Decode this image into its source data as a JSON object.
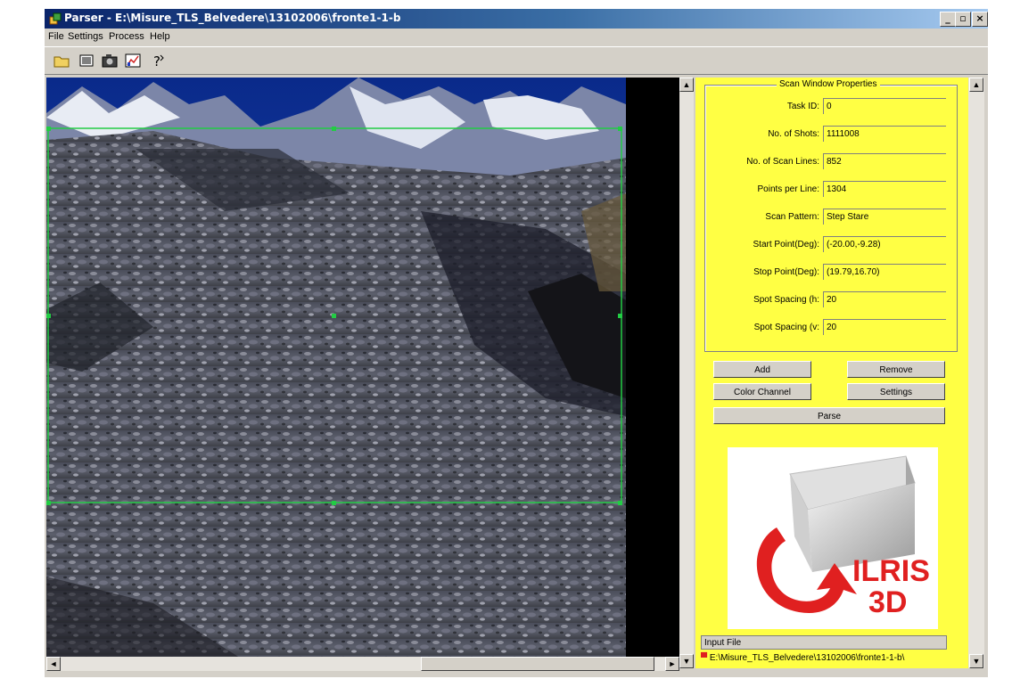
{
  "window": {
    "title": "Parser - E:\\Misure_TLS_Belvedere\\13102006\\fronte1-1-b",
    "minimize": "_",
    "maximize": "▫",
    "close": "×"
  },
  "menu": {
    "file": "File",
    "settings": "Settings",
    "process": "Process",
    "help": "Help"
  },
  "toolbar": {
    "icons": [
      "open-folder-icon",
      "image-icon",
      "camera-icon",
      "chart-icon",
      "help-icon"
    ]
  },
  "panel": {
    "group_title": "Scan Window Properties",
    "properties": [
      {
        "label": "Task ID:",
        "value": "0"
      },
      {
        "label": "No. of Shots:",
        "value": "1111008"
      },
      {
        "label": "No. of Scan Lines:",
        "value": "852"
      },
      {
        "label": "Points per Line:",
        "value": "1304"
      },
      {
        "label": "Scan Pattern:",
        "value": "Step Stare"
      },
      {
        "label": "Start Point(Deg):",
        "value": "(-20.00,-9.28)"
      },
      {
        "label": "Stop Point(Deg):",
        "value": "(19.79,16.70)"
      },
      {
        "label": "Spot Spacing (h:",
        "value": "20"
      },
      {
        "label": "Spot Spacing (v:",
        "value": "20"
      }
    ],
    "buttons": {
      "add": "Add",
      "remove": "Remove",
      "color_channel": "Color Channel",
      "settings": "Settings",
      "parse": "Parse"
    },
    "logo": {
      "line1": "ILRIS",
      "line2": "3D"
    },
    "input_file_label": "Input File",
    "input_file_path": "E:\\Misure_TLS_Belvedere\\13102006\\fronte1-1-b\\"
  },
  "colors": {
    "panel_bg": "#ffff44",
    "selection": "#22cc44",
    "logo_red": "#e02020"
  }
}
